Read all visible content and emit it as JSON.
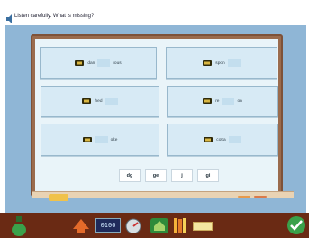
{
  "question": {
    "text": "Listen carefully. What is missing?"
  },
  "cards": [
    {
      "parts": [
        "dan",
        "rous"
      ],
      "blanks": 1
    },
    {
      "parts": [
        "spon"
      ],
      "blanks": 1
    },
    {
      "parts": [
        "hed"
      ],
      "blanks": 1
    },
    {
      "parts": [
        "re",
        "on"
      ],
      "blanks": 1
    },
    {
      "parts": [
        "oke"
      ],
      "blanks": 1
    },
    {
      "parts": [
        "cotta"
      ],
      "blanks": 1
    }
  ],
  "choices": [
    "dg",
    "ge",
    "j",
    "gi"
  ],
  "footer": {
    "counter": "0100"
  },
  "colors": {
    "board": "#e9f4f9",
    "frame": "#9a6b4d",
    "footer": "#6a2a14",
    "accent_green": "#3aa14a"
  }
}
